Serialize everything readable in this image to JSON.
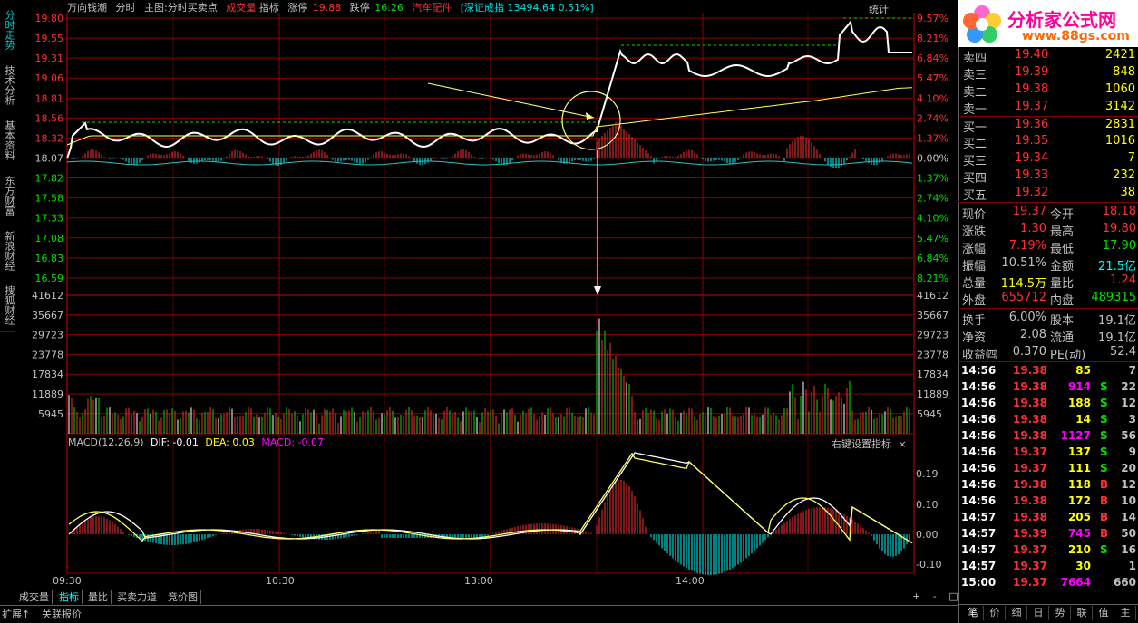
{
  "side_tabs": [
    {
      "label": "分时走势",
      "active": true
    },
    {
      "label": "技术分析",
      "active": false
    },
    {
      "label": "基本资料",
      "active": false
    },
    {
      "label": "东方财富",
      "active": false
    },
    {
      "label": "新浪财经",
      "active": false
    },
    {
      "label": "搜狐财经",
      "active": false
    }
  ],
  "header": {
    "stock_name": "万向钱潮",
    "chart_mode": "分时",
    "main_chart": "主图:分时买卖点",
    "volume_label": "成交量",
    "indicator_label": "指标",
    "limit_up_label": "涨停",
    "limit_up_value": "19.88",
    "limit_down_label": "跌停",
    "limit_down_value": "16.26",
    "sector": "汽车配件",
    "index_info": "[深证成指 13494.64 0.51%]",
    "stats_label": "统计"
  },
  "price_axis": {
    "left": [
      "19.80",
      "19.55",
      "19.31",
      "19.06",
      "18.81",
      "18.56",
      "18.32",
      "18.07",
      "17.82",
      "17.58",
      "17.33",
      "17.08",
      "16.83",
      "16.59"
    ],
    "right": [
      "9.57%",
      "8.21%",
      "6.84%",
      "5.47%",
      "4.10%",
      "2.74%",
      "1.37%",
      "0.00%",
      "1.37%",
      "2.74%",
      "4.10%",
      "5.47%",
      "6.84%",
      "8.21%"
    ]
  },
  "volume_axis": [
    "41612",
    "35667",
    "29723",
    "23778",
    "17834",
    "11889",
    "5945"
  ],
  "macd": {
    "title": "MACD(12,26,9)",
    "dif": "DIF: -0.01",
    "dea": "DEA: 0.03",
    "macd": "MACD: -0.07",
    "settings": "右键设置指标",
    "close_glyph": "×",
    "axis": [
      "0.19",
      "0.10",
      "0.00",
      "-0.10"
    ]
  },
  "time_axis": [
    "09:30",
    "10:30",
    "13:00",
    "14:00"
  ],
  "bottom_tabs": [
    "成交量",
    "指标",
    "量比",
    "买卖力道",
    "竞价图"
  ],
  "bottom_controls": [
    "+",
    "-",
    "□"
  ],
  "expand_tabs": [
    "扩展↑",
    "关联报价"
  ],
  "logo": {
    "title": "分析家公式网",
    "url": "www.88gs.com"
  },
  "order_book": {
    "asks": [
      {
        "label": "卖四",
        "price": "19.40",
        "vol": "2421"
      },
      {
        "label": "卖三",
        "price": "19.39",
        "vol": "848"
      },
      {
        "label": "卖二",
        "price": "19.38",
        "vol": "1060"
      },
      {
        "label": "卖一",
        "price": "19.37",
        "vol": "3142"
      }
    ],
    "bids": [
      {
        "label": "买一",
        "price": "19.36",
        "vol": "2831"
      },
      {
        "label": "买二",
        "price": "19.35",
        "vol": "1016"
      },
      {
        "label": "买三",
        "price": "19.34",
        "vol": "7"
      },
      {
        "label": "买四",
        "price": "19.33",
        "vol": "232"
      },
      {
        "label": "买五",
        "price": "19.32",
        "vol": "38"
      }
    ]
  },
  "quote": [
    {
      "l1": "现价",
      "v1": "19.37",
      "c1": "#ff3030",
      "l2": "今开",
      "v2": "18.18",
      "c2": "#ff3030"
    },
    {
      "l1": "涨跌",
      "v1": "1.30",
      "c1": "#ff3030",
      "l2": "最高",
      "v2": "19.80",
      "c2": "#ff3030"
    },
    {
      "l1": "涨幅",
      "v1": "7.19%",
      "c1": "#ff3030",
      "l2": "最低",
      "v2": "17.90",
      "c2": "#00e000"
    },
    {
      "l1": "振幅",
      "v1": "10.51%",
      "c1": "#c0c0c0",
      "l2": "金额",
      "v2": "21.5亿",
      "c2": "#00ffff"
    },
    {
      "l1": "总量",
      "v1": "114.5万",
      "c1": "#ffff00",
      "l2": "量比",
      "v2": "1.24",
      "c2": "#ff3030"
    },
    {
      "l1": "外盘",
      "v1": "655712",
      "c1": "#ff3030",
      "l2": "内盘",
      "v2": "489315",
      "c2": "#00e000"
    }
  ],
  "fundamentals": [
    {
      "l1": "换手",
      "v1": "6.00%",
      "l2": "股本",
      "v2": "19.1亿"
    },
    {
      "l1": "净资",
      "v1": "2.08",
      "l2": "流通",
      "v2": "19.1亿"
    },
    {
      "l1": "收益㈣",
      "v1": "0.370",
      "l2": "PE(动)",
      "v2": "52.4"
    }
  ],
  "ticks": [
    {
      "t": "14:56",
      "p": "19.38",
      "v": "85",
      "d": "",
      "n": "7",
      "vc": "#ffff00"
    },
    {
      "t": "14:56",
      "p": "19.38",
      "v": "914",
      "d": "S",
      "n": "22",
      "vc": "#ff00ff"
    },
    {
      "t": "14:56",
      "p": "19.38",
      "v": "188",
      "d": "S",
      "n": "12",
      "vc": "#ffff00"
    },
    {
      "t": "14:56",
      "p": "19.38",
      "v": "14",
      "d": "S",
      "n": "3",
      "vc": "#ffff00"
    },
    {
      "t": "14:56",
      "p": "19.38",
      "v": "1127",
      "d": "S",
      "n": "56",
      "vc": "#ff00ff"
    },
    {
      "t": "14:56",
      "p": "19.37",
      "v": "137",
      "d": "S",
      "n": "9",
      "vc": "#ffff00"
    },
    {
      "t": "14:56",
      "p": "19.37",
      "v": "111",
      "d": "S",
      "n": "20",
      "vc": "#ffff00"
    },
    {
      "t": "14:56",
      "p": "19.38",
      "v": "118",
      "d": "B",
      "n": "12",
      "vc": "#ffff00"
    },
    {
      "t": "14:56",
      "p": "19.38",
      "v": "172",
      "d": "B",
      "n": "10",
      "vc": "#ffff00"
    },
    {
      "t": "14:57",
      "p": "19.38",
      "v": "205",
      "d": "B",
      "n": "14",
      "vc": "#ffff00"
    },
    {
      "t": "14:57",
      "p": "19.39",
      "v": "745",
      "d": "B",
      "n": "50",
      "vc": "#ff00ff"
    },
    {
      "t": "14:57",
      "p": "19.37",
      "v": "210",
      "d": "S",
      "n": "16",
      "vc": "#ffff00"
    },
    {
      "t": "14:57",
      "p": "19.37",
      "v": "30",
      "d": "",
      "n": "1",
      "vc": "#ffff00"
    },
    {
      "t": "15:00",
      "p": "19.37",
      "v": "7664",
      "d": "",
      "n": "660",
      "vc": "#ff00ff"
    }
  ],
  "right_tabs": [
    "笔",
    "价",
    "细",
    "日",
    "势",
    "联",
    "值",
    "主"
  ],
  "colors": {
    "grid": "#8b0000",
    "up": "#ff3030",
    "down": "#00e000",
    "price_line": "#ffffff",
    "avg_line": "#ffff60",
    "cyan": "#00ffff",
    "yellow": "#ffff00",
    "magenta": "#ff00ff",
    "arrow": "#ffff80"
  }
}
